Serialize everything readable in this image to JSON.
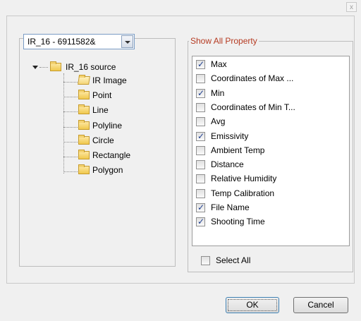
{
  "window": {
    "close_glyph": "x"
  },
  "source_combo": {
    "value": "IR_16 - 6911582&"
  },
  "tree": {
    "root": {
      "label": "IR_16 source",
      "expanded": true
    },
    "children": [
      {
        "label": "IR Image",
        "icon": "folder-open-icon"
      },
      {
        "label": "Point",
        "icon": "folder-icon"
      },
      {
        "label": "Line",
        "icon": "folder-icon"
      },
      {
        "label": "Polyline",
        "icon": "folder-icon"
      },
      {
        "label": "Circle",
        "icon": "folder-icon"
      },
      {
        "label": "Rectangle",
        "icon": "folder-icon"
      },
      {
        "label": "Polygon",
        "icon": "folder-icon"
      }
    ]
  },
  "property_group": {
    "title": "Show All Property",
    "items": [
      {
        "label": "Max",
        "checked": true
      },
      {
        "label": "Coordinates of Max ...",
        "checked": false
      },
      {
        "label": "Min",
        "checked": true
      },
      {
        "label": "Coordinates of Min T...",
        "checked": false
      },
      {
        "label": "Avg",
        "checked": false
      },
      {
        "label": "Emissivity",
        "checked": true
      },
      {
        "label": "Ambient Temp",
        "checked": false
      },
      {
        "label": "Distance",
        "checked": false
      },
      {
        "label": "Relative Humidity",
        "checked": false
      },
      {
        "label": "Temp Calibration",
        "checked": false
      },
      {
        "label": "File Name",
        "checked": true
      },
      {
        "label": "Shooting Time",
        "checked": true
      }
    ],
    "select_all": {
      "label": "Select All",
      "checked": false
    }
  },
  "buttons": {
    "ok_label": "OK",
    "cancel_label": "Cancel"
  },
  "colors": {
    "group_title": "#b53a21",
    "checkmark": "#1f3f8f",
    "folder": "#f0c84d"
  }
}
